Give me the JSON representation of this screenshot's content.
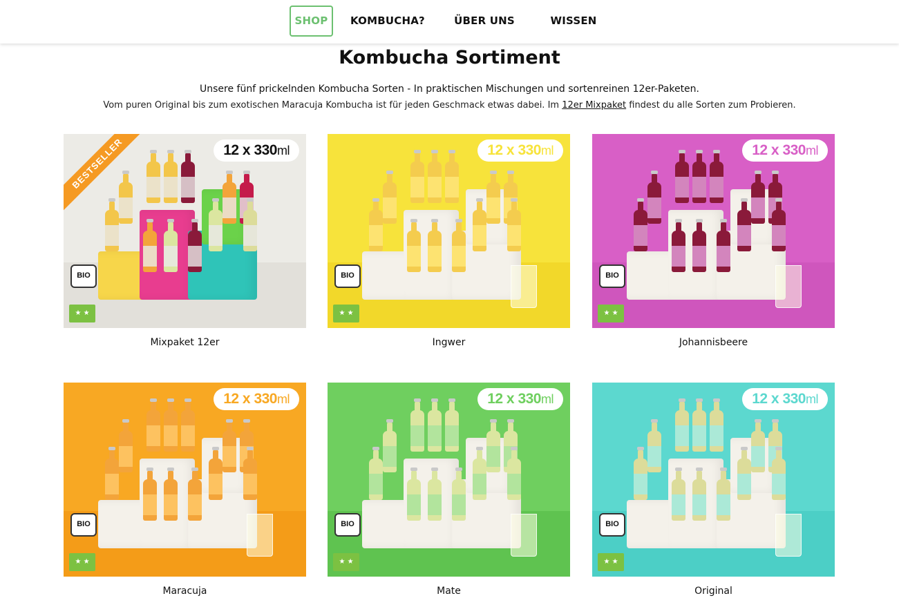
{
  "nav": {
    "items": [
      {
        "label": "SHOP",
        "active": true
      },
      {
        "label": "KOMBUCHA?",
        "active": false
      },
      {
        "label": "ÜBER UNS",
        "active": false
      },
      {
        "label": "WISSEN",
        "active": false
      }
    ]
  },
  "page": {
    "title": "Kombucha Sortiment",
    "intro_line1": "Unsere fünf prickelnden Kombucha Sorten - In praktischen Mischungen und sortenreinen 12er-Paketen.",
    "intro_line2_before": "Vom puren Original bis zum exotischen Maracuja Kombucha ist für jeden Geschmack etwas dabei. Im ",
    "intro_link": "12er Mixpaket",
    "intro_line2_after": " findest du alle Sorten zum Probieren."
  },
  "badges": {
    "size_count": "12 x ",
    "size_amount": "330",
    "size_unit": "ml",
    "bio": "BIO",
    "bestseller": "BESTSELLER"
  },
  "products": [
    {
      "name": "Mixpaket 12er",
      "bg": "#ecebe6",
      "floor": "#e2e0da",
      "bottle": "#f3c64a",
      "accent": "#e8e8e8"
    },
    {
      "name": "Ingwer",
      "bg": "#f7e33b",
      "floor": "#f2d82a",
      "bottle": "#f4cc4e",
      "accent": "#ffe97a"
    },
    {
      "name": "Johannisbeere",
      "bg": "#d85fc6",
      "floor": "#cf56bd",
      "bottle": "#8a1a3a",
      "accent": "#e5a0df"
    },
    {
      "name": "Maracuja",
      "bg": "#f8a823",
      "floor": "#f49c18",
      "bottle": "#f3a43a",
      "accent": "#ffc96a"
    },
    {
      "name": "Mate",
      "bg": "#6fcf5f",
      "floor": "#5fc350",
      "bottle": "#dbe6a0",
      "accent": "#a8e39c"
    },
    {
      "name": "Original",
      "bg": "#5cd8cf",
      "floor": "#4ccfc6",
      "bottle": "#dcdc9a",
      "accent": "#9fece6"
    }
  ],
  "colors": {
    "accent_green": "#6cc070",
    "bestseller_orange": "#f59a23"
  }
}
